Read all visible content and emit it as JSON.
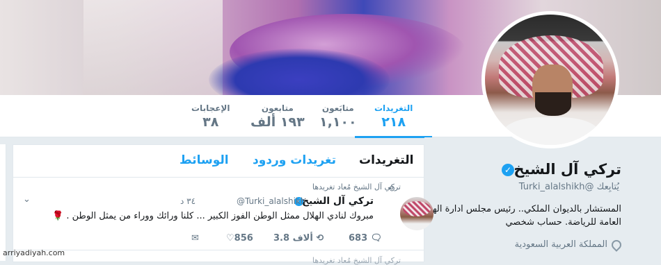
{
  "profile": {
    "name": "تركي آل الشيخ",
    "handle": "@Turki_alalshikh",
    "follows_you": "يُتابِعك",
    "bio": "المستشار بالديوان الملكي.. رئيس مجلس ادارة الهيئة العامة للرياضة. حساب شخصي",
    "location": "المملكة العربية السعودية"
  },
  "stats": [
    {
      "label": "التغريدات",
      "value": "٢١٨"
    },
    {
      "label": "متابَعون",
      "value": "١,١٠٠"
    },
    {
      "label": "متابعون",
      "value": "١٩٣ ألف"
    },
    {
      "label": "الإعجابات",
      "value": "٣٨"
    }
  ],
  "tabs": {
    "tweets": "التغريدات",
    "tweets_replies": "تغريدات وردود",
    "media": "الوسائط"
  },
  "tweet": {
    "retweeted_by": "تركي آل الشيخ مُعاد تغريدها",
    "author_name": "تركي آل الشيخ",
    "author_handle": "@Turki_alalshikh",
    "time": "٣٤ د",
    "text": "مبروك لنادي الهلال ممثل الوطن الفوز الكبير ... كلنا ورائك ووراء من يمثل الوطن .",
    "rose": "🌹",
    "replies": "683",
    "retweets": "3.8 ألاف",
    "likes": "856"
  },
  "next_tweet": {
    "retweeted_by": "تركي آل الشيخ مُعاد تغريدها"
  },
  "watermark": "arriyadiyah.com",
  "colors": {
    "accent": "#1da1f2",
    "text": "#14171a",
    "muted": "#657786"
  }
}
